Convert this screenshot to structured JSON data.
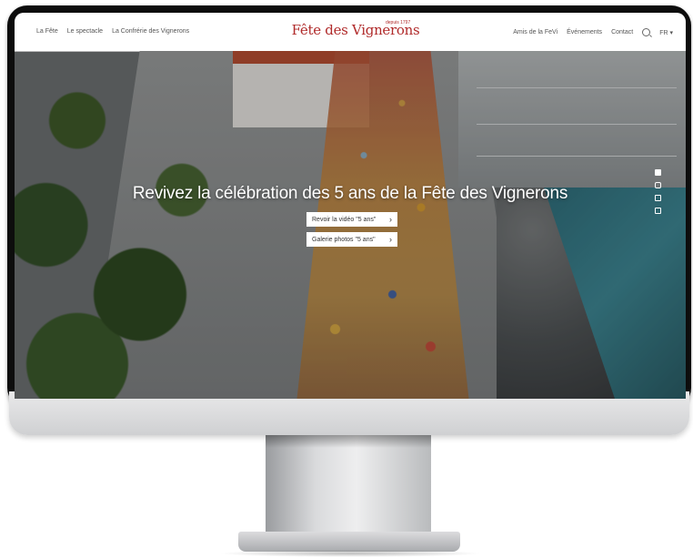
{
  "nav": {
    "left_links": [
      "La Fête",
      "Le spectacle",
      "La Confrérie des Vignerons"
    ],
    "logo": "Fête des Vignerons",
    "logo_tagline": "depuis 1797",
    "right_links": [
      "Amis de la FeVi",
      "Événements",
      "Contact"
    ],
    "language": "FR"
  },
  "hero": {
    "headline": "Revivez la célébration des 5 ans de la Fête des Vignerons",
    "buttons": [
      "Revoir la vidéo \"5 ans\"",
      "Galerie photos \"5 ans\""
    ]
  },
  "social_icons": [
    "facebook-icon",
    "instagram-icon",
    "twitter-icon",
    "linkedin-icon"
  ],
  "colors": {
    "brand": "#b02a2a"
  }
}
